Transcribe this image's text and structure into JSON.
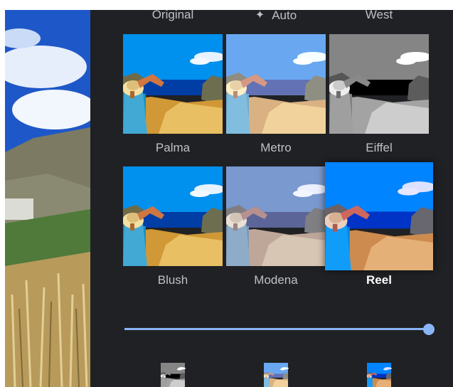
{
  "labels_row0": [
    {
      "label": "Original",
      "icon": ""
    },
    {
      "label": "Auto",
      "icon": "sparkle-icon"
    },
    {
      "label": "West",
      "icon": ""
    }
  ],
  "rows": [
    [
      {
        "label": "Palma",
        "variant": "vivid",
        "selected": false
      },
      {
        "label": "Metro",
        "variant": "bright",
        "selected": false
      },
      {
        "label": "Eiffel",
        "variant": "bw",
        "selected": false
      }
    ],
    [
      {
        "label": "Blush",
        "variant": "vivid",
        "selected": false
      },
      {
        "label": "Modena",
        "variant": "muted",
        "selected": false
      },
      {
        "label": "Reel",
        "variant": "deep",
        "selected": true
      }
    ]
  ],
  "intensity": 1.0,
  "colors": {
    "panel": "#202124",
    "accent": "#8ab4f8",
    "label": "#bdc1c6",
    "label_selected": "#ffffff"
  }
}
